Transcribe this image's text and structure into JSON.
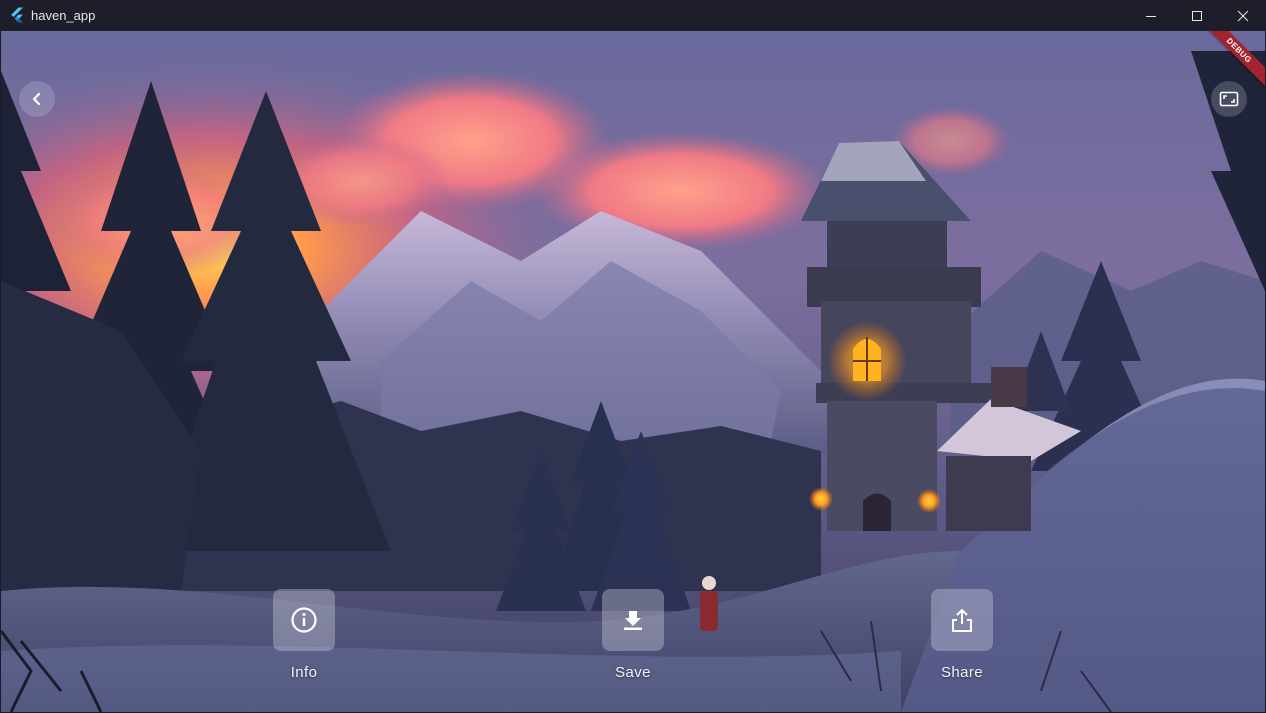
{
  "window": {
    "title": "haven_app",
    "app_icon": "flutter-logo-icon",
    "controls": [
      "minimize-icon",
      "maximize-icon",
      "close-icon"
    ]
  },
  "debug_banner": "DEBUG",
  "top_controls": {
    "back_icon": "chevron-left-icon",
    "fullscreen_icon": "fullscreen-icon"
  },
  "actions": [
    {
      "label": "Info",
      "icon": "info-icon"
    },
    {
      "label": "Save",
      "icon": "download-icon"
    },
    {
      "label": "Share",
      "icon": "share-icon"
    }
  ],
  "colors": {
    "titlebar": "#1d1e2a",
    "debug_ribbon": "#a3242d",
    "sky_glow": "#f2846b",
    "window_light": "#ffb32a"
  }
}
